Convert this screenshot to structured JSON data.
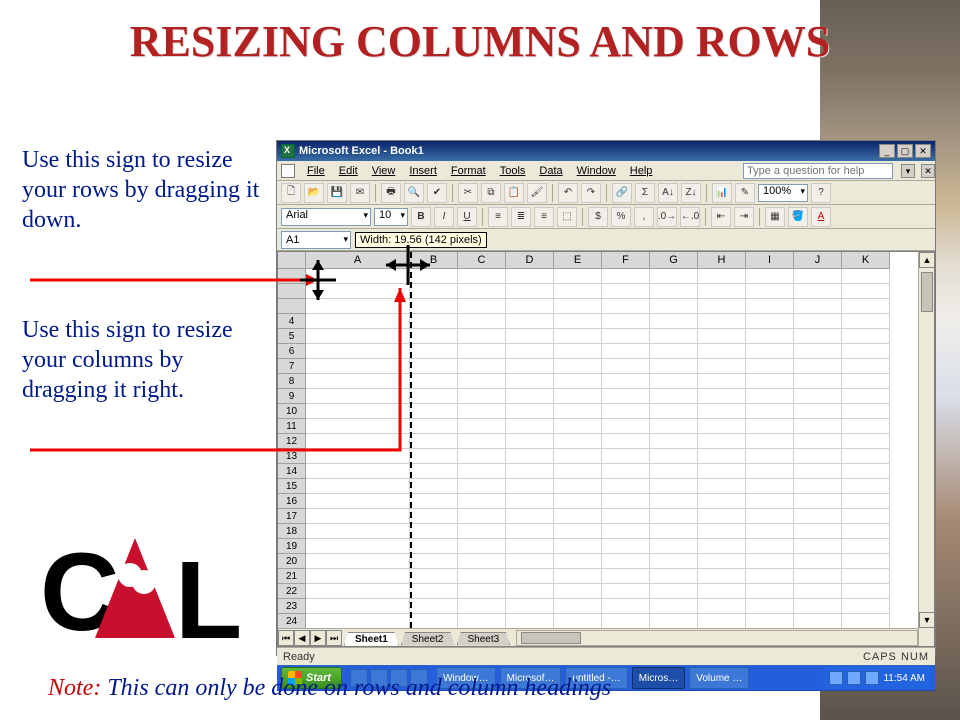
{
  "slide": {
    "title": "RESIZING COLUMNS AND ROWS",
    "instruction1": "Use this sign to resize your rows by dragging it down.",
    "instruction2": "Use this sign to resize your columns by dragging it right.",
    "note_prefix": "Note:",
    "note_body": " This can only be done on rows and column headings"
  },
  "excel": {
    "title": "Microsoft Excel - Book1",
    "menu": [
      "File",
      "Edit",
      "View",
      "Insert",
      "Format",
      "Tools",
      "Data",
      "Window",
      "Help"
    ],
    "help_placeholder": "Type a question for help",
    "font_name": "Arial",
    "font_size": "10",
    "zoom": "100%",
    "name_box": "A1",
    "resize_tooltip": "Width: 19.56 (142 pixels)",
    "columns": [
      "A",
      "B",
      "C",
      "D",
      "E",
      "F",
      "G",
      "H",
      "I",
      "J",
      "K"
    ],
    "rows": [
      "",
      "",
      "",
      "4",
      "5",
      "6",
      "7",
      "8",
      "9",
      "10",
      "11",
      "12",
      "13",
      "14",
      "15",
      "16",
      "17",
      "18",
      "19",
      "20",
      "21",
      "22",
      "23",
      "24"
    ],
    "resize_guide_col_after": "A",
    "sheet_tabs": [
      "Sheet1",
      "Sheet2",
      "Sheet3"
    ],
    "active_sheet": "Sheet1",
    "status": "Ready",
    "caps": "CAPS NUM"
  },
  "taskbar": {
    "start": "Start",
    "buttons": [
      "Window…",
      "Microsof…",
      "untitled -…",
      "Micros…",
      "Volume …"
    ],
    "active_index": 3,
    "time": "11:54 AM"
  },
  "logo_text": "CAL"
}
